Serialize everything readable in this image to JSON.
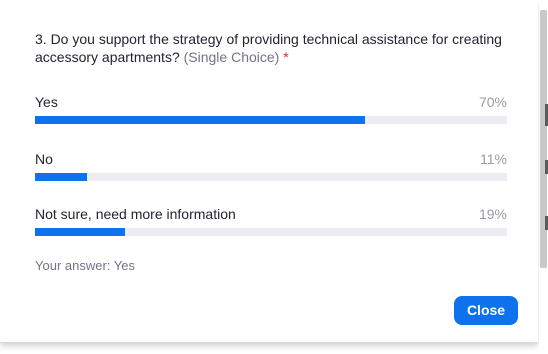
{
  "poll": {
    "question_text": "3. Do you support the strategy of providing technical assistance for creating accessory apartments?",
    "choice_type": "(Single Choice)",
    "required_mark": "*",
    "options": [
      {
        "label": "Yes",
        "percent_label": "70%",
        "percent": 70
      },
      {
        "label": "No",
        "percent_label": "11%",
        "percent": 11
      },
      {
        "label": "Not sure, need more information",
        "percent_label": "19%",
        "percent": 19
      }
    ],
    "your_answer": "Your answer: Yes"
  },
  "footer": {
    "close_label": "Close"
  },
  "colors": {
    "accent": "#0e72ed",
    "track": "#ececf1",
    "required": "#e02828",
    "muted_text": "#747487"
  }
}
